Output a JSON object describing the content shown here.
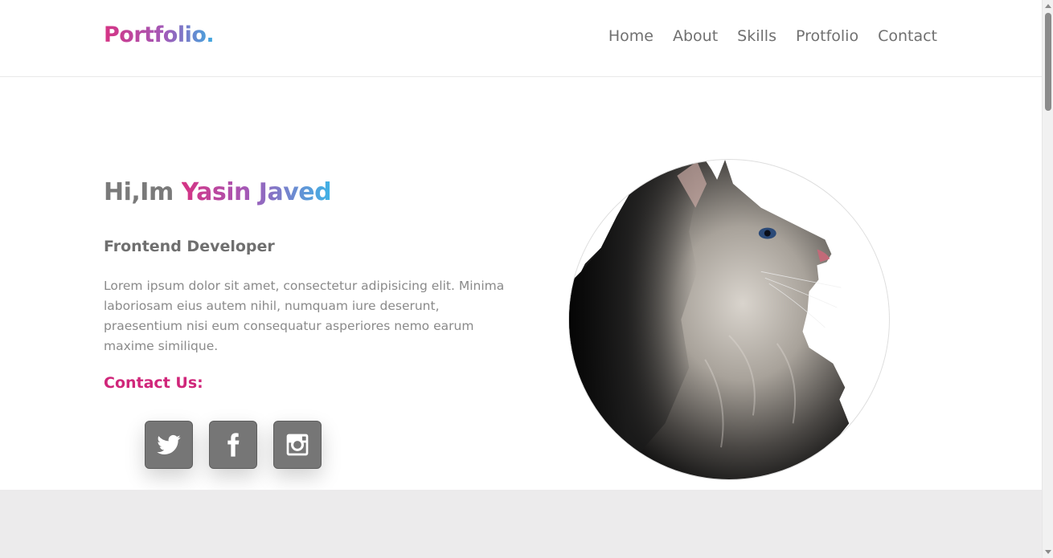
{
  "header": {
    "logo": "Portfolio.",
    "nav": [
      "Home",
      "About",
      "Skills",
      "Protfolio",
      "Contact"
    ]
  },
  "hero": {
    "greeting_prefix": "Hi,Im ",
    "name": "Yasin Javed",
    "role": "Frontend Developer",
    "intro": "Lorem ipsum dolor sit amet, consectetur adipisicing elit. Minima laboriosam eius autem nihil, numquam iure deserunt, praesentium nisi eum consequatur asperiores nemo earum maxime similique.",
    "contact_title": "Contact Us:",
    "socials": [
      "twitter-icon",
      "facebook-icon",
      "instagram-icon"
    ]
  },
  "colors": {
    "accent_pink": "#d63384",
    "accent_purple": "#a25ab8",
    "accent_blue": "#3fa9e0",
    "text_gray": "#707070",
    "band": "#ecebec"
  }
}
